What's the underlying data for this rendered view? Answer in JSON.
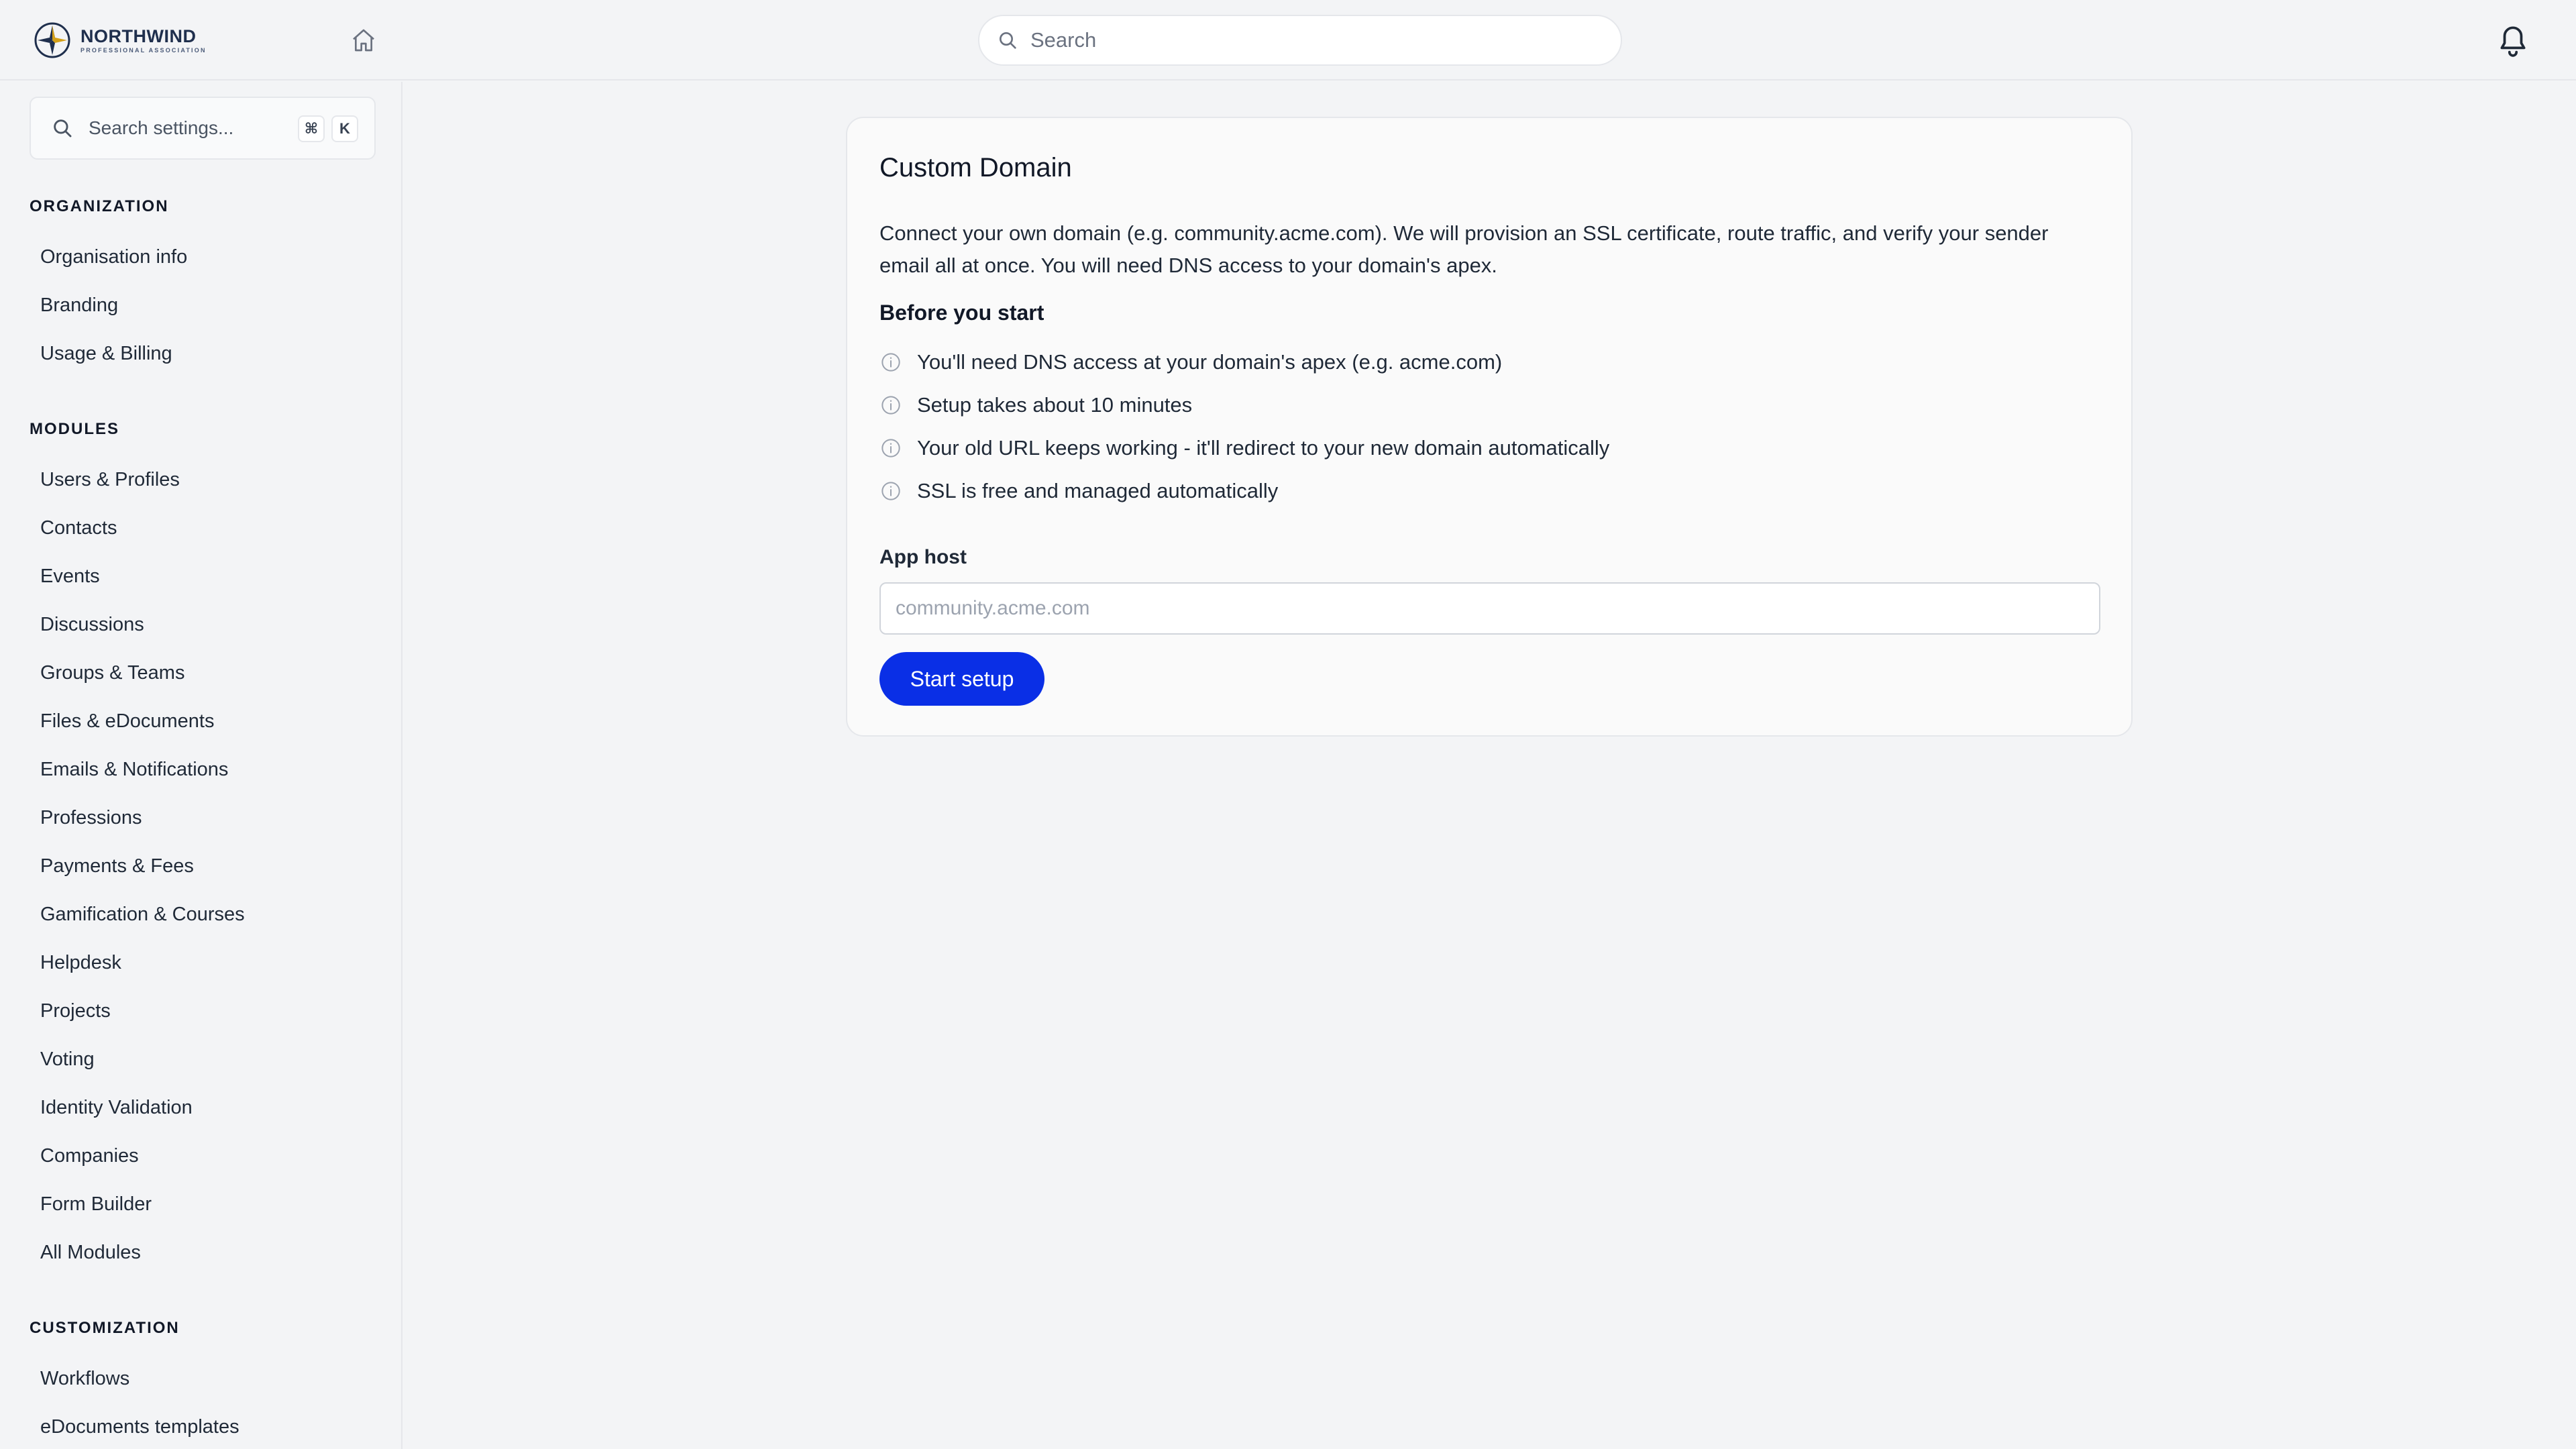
{
  "header": {
    "logo_name": "NORTHWIND",
    "logo_sub": "PROFESSIONAL ASSOCIATION",
    "search_placeholder": "Search"
  },
  "sidebar": {
    "search_placeholder": "Search settings...",
    "shortcut_keys": [
      "⌘",
      "K"
    ],
    "sections": [
      {
        "title": "ORGANIZATION",
        "items": [
          "Organisation info",
          "Branding",
          "Usage & Billing"
        ]
      },
      {
        "title": "MODULES",
        "items": [
          "Users & Profiles",
          "Contacts",
          "Events",
          "Discussions",
          "Groups & Teams",
          "Files & eDocuments",
          "Emails & Notifications",
          "Professions",
          "Payments & Fees",
          "Gamification & Courses",
          "Helpdesk",
          "Projects",
          "Voting",
          "Identity Validation",
          "Companies",
          "Form Builder",
          "All Modules"
        ]
      },
      {
        "title": "CUSTOMIZATION",
        "items": [
          "Workflows",
          "eDocuments templates"
        ]
      }
    ]
  },
  "main": {
    "card_title": "Custom Domain",
    "description": "Connect your own domain (e.g. community.acme.com). We will provision an SSL certificate, route traffic, and verify your sender email all at once. You will need DNS access to your domain's apex.",
    "before_title": "Before you start",
    "tips": [
      "You'll need DNS access at your domain's apex (e.g. acme.com)",
      "Setup takes about 10 minutes",
      "Your old URL keeps working - it'll redirect to your new domain automatically",
      "SSL is free and managed automatically"
    ],
    "field_label": "App host",
    "field_placeholder": "community.acme.com",
    "field_value": "",
    "button_label": "Start setup"
  },
  "colors": {
    "accent": "#0a2fe6",
    "background": "#f3f4f6",
    "card": "#fafafa",
    "logo": "#1f2f4d"
  },
  "icons": [
    "logo-compass-icon",
    "home-icon",
    "search-icon",
    "bell-icon",
    "info-icon"
  ]
}
